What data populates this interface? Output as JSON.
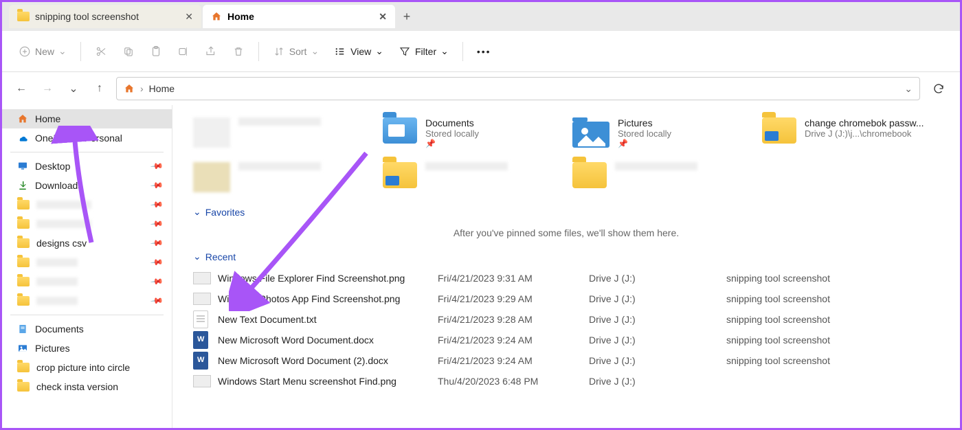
{
  "tabs": [
    {
      "label": "snipping tool screenshot",
      "active": false,
      "icon": "folder"
    },
    {
      "label": "Home",
      "active": true,
      "icon": "home"
    }
  ],
  "toolbar": {
    "new_label": "New",
    "sort_label": "Sort",
    "view_label": "View",
    "filter_label": "Filter"
  },
  "breadcrumb": {
    "root": "Home"
  },
  "sidebar": {
    "top": [
      {
        "label": "Home",
        "icon": "home",
        "selected": true
      },
      {
        "label": "OneDrive - Personal",
        "icon": "onedrive"
      }
    ],
    "mid": [
      {
        "label": "Desktop",
        "icon": "desktop",
        "pinned": true
      },
      {
        "label": "Downloads",
        "icon": "download",
        "pinned": true
      },
      {
        "label": "",
        "icon": "folder",
        "pinned": true,
        "blur": true
      },
      {
        "label": "",
        "icon": "folder",
        "pinned": true,
        "blur": true
      },
      {
        "label": "designs csv",
        "icon": "folder",
        "pinned": true
      },
      {
        "label": "",
        "icon": "folder",
        "pinned": true,
        "blur": true
      },
      {
        "label": "",
        "icon": "folder",
        "pinned": true,
        "blur": true
      },
      {
        "label": "",
        "icon": "folder",
        "pinned": true,
        "blur": true
      }
    ],
    "bottom": [
      {
        "label": "Documents",
        "icon": "doc"
      },
      {
        "label": "Pictures",
        "icon": "pic"
      },
      {
        "label": "crop picture into circle",
        "icon": "folder"
      },
      {
        "label": "check insta version",
        "icon": "folder"
      }
    ]
  },
  "quick_access": [
    {
      "title": "",
      "subtitle": "",
      "type": "pix"
    },
    {
      "title": "Documents",
      "subtitle": "Stored locally",
      "pinned": true,
      "type": "docfolder"
    },
    {
      "title": "Pictures",
      "subtitle": "Stored locally",
      "pinned": true,
      "type": "picfolder"
    },
    {
      "title": "change chromebok passw...",
      "subtitle": "Drive J (J:)\\j...\\chromebook",
      "type": "tagfolder"
    },
    {
      "title": "",
      "subtitle": "",
      "type": "pix2"
    },
    {
      "title": "",
      "subtitle": "",
      "type": "tagfolder-blur"
    },
    {
      "title": "",
      "subtitle": "",
      "type": "folder-blur"
    }
  ],
  "sections": {
    "favorites": "Favorites",
    "favorites_empty": "After you've pinned some files, we'll show them here.",
    "recent": "Recent"
  },
  "recent": [
    {
      "name": "Windows File Explorer Find Screenshot.png",
      "date": "Fri/4/21/2023 9:31 AM",
      "loc": "Drive J (J:)",
      "tag": "snipping tool screenshot",
      "ico": "png"
    },
    {
      "name": "Windows Photos App Find Screenshot.png",
      "date": "Fri/4/21/2023 9:29 AM",
      "loc": "Drive J (J:)",
      "tag": "snipping tool screenshot",
      "ico": "png"
    },
    {
      "name": "New Text Document.txt",
      "date": "Fri/4/21/2023 9:28 AM",
      "loc": "Drive J (J:)",
      "tag": "snipping tool screenshot",
      "ico": "txt"
    },
    {
      "name": "New Microsoft Word Document.docx",
      "date": "Fri/4/21/2023 9:24 AM",
      "loc": "Drive J (J:)",
      "tag": "snipping tool screenshot",
      "ico": "word"
    },
    {
      "name": "New Microsoft Word Document (2).docx",
      "date": "Fri/4/21/2023 9:24 AM",
      "loc": "Drive J (J:)",
      "tag": "snipping tool screenshot",
      "ico": "word"
    },
    {
      "name": "Windows Start Menu screenshot Find.png",
      "date": "Thu/4/20/2023 6:48 PM",
      "loc": "Drive J (J:)",
      "tag": "",
      "ico": "png"
    }
  ]
}
